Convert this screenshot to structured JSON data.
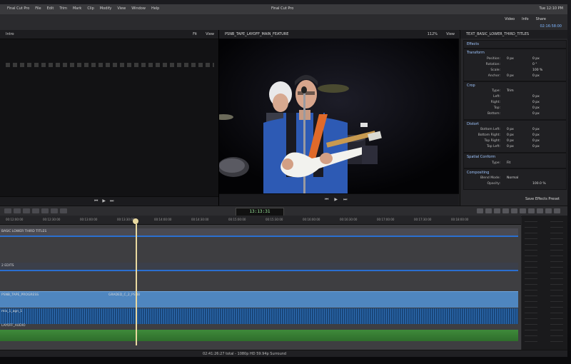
{
  "menubar": {
    "items": [
      "Final Cut Pro",
      "File",
      "Edit",
      "Trim",
      "Mark",
      "Clip",
      "Modify",
      "View",
      "Window",
      "Help"
    ],
    "app_title": "Final Cut Pro",
    "status": "Tue 12:10 PM"
  },
  "toolbar": {
    "tabs": [
      "Video",
      "Info",
      "Share"
    ],
    "timecode": "02:16:58:00"
  },
  "viewer_left": {
    "title": "Intro",
    "fit": "Fit",
    "view": "View"
  },
  "viewer_center": {
    "clip_name": "PSNB_TAPE_LAYOFF_MAIN_FEATURE",
    "zoom": "112%",
    "view": "View"
  },
  "inspector": {
    "title": "TEXT_BASIC_LOWER_THIRD_TITLES",
    "effects": "Effects",
    "transform": {
      "title": "Transform",
      "rows": [
        {
          "label": "Position:",
          "v1": "0 px",
          "v2": "0 px"
        },
        {
          "label": "Rotation:",
          "v1": "",
          "v2": "0 °"
        },
        {
          "label": "Scale:",
          "v1": "",
          "v2": "100 %"
        },
        {
          "label": "Anchor:",
          "v1": "0 px",
          "v2": "0 px"
        }
      ]
    },
    "crop": {
      "title": "Crop",
      "type": "Trim",
      "rows": [
        {
          "label": "Left:",
          "v": "0 px"
        },
        {
          "label": "Right:",
          "v": "0 px"
        },
        {
          "label": "Top:",
          "v": "0 px"
        },
        {
          "label": "Bottom:",
          "v": "0 px"
        }
      ]
    },
    "distort": {
      "title": "Distort",
      "rows": [
        {
          "label": "Bottom Left:",
          "v1": "0 px",
          "v2": "0 px"
        },
        {
          "label": "Bottom Right:",
          "v1": "0 px",
          "v2": "0 px"
        },
        {
          "label": "Top Right:",
          "v1": "0 px",
          "v2": "0 px"
        },
        {
          "label": "Top Left:",
          "v1": "0 px",
          "v2": "0 px"
        }
      ]
    },
    "spatial": {
      "title": "Spatial Conform",
      "type": "Fit"
    },
    "compositing": {
      "title": "Compositing",
      "blend_mode": "Normal",
      "opacity": "100.0 %"
    },
    "save_preset": "Save Effects Preset"
  },
  "timeline_toolbar": {
    "timecode": "13:13:31"
  },
  "timeline": {
    "ruler_ticks": [
      "00:12:00:00",
      "00:12:30:00",
      "00:13:00:00",
      "00:13:30:00",
      "00:14:00:00",
      "00:14:30:00",
      "00:15:00:00",
      "00:15:30:00",
      "00:16:00:00",
      "00:16:30:00",
      "00:17:00:00",
      "00:17:30:00",
      "00:18:00:00"
    ],
    "title_lane": "BASIC LOWER THIRD TITLES",
    "lane_2": "2 EDITS",
    "main_clip": "PSNB_TAPE_PROGRESS",
    "main_clip_2": "GRADED_C_2_PSNB",
    "audio_lane": "LAYOFF_AUDIO",
    "audio_sub": "mix_1_agn_1"
  },
  "status_bar": {
    "text": "02:41:26:27 total - 1080p HD 59.94p Surround"
  },
  "colors": {
    "accent_blue": "#4a8fd8",
    "clip_blue": "#4f86bf",
    "audio_green": "#3e8a3a",
    "playhead": "#e9d9a0"
  }
}
